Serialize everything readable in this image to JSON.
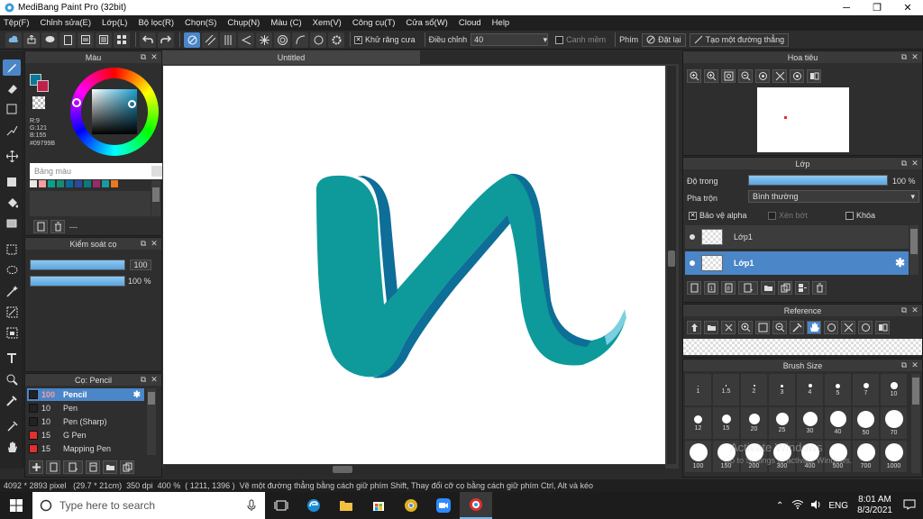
{
  "window": {
    "title": "MediBang Paint Pro (32bit)",
    "controls": [
      "minimize-icon",
      "maximize-icon",
      "close-icon"
    ]
  },
  "menu": [
    "Tệp(F)",
    "Chỉnh sửa(E)",
    "Lớp(L)",
    "Bộ lọc(R)",
    "Chọn(S)",
    "Chụp(N)",
    "Màu (C)",
    "Xem(V)",
    "Công cụ(T)",
    "Cửa sổ(W)",
    "Cloud",
    "Help"
  ],
  "toolbar": {
    "antialias_label": "Khử răng cưa",
    "antialias_checked": true,
    "correction_label": "Điều chỉnh",
    "correction_value": "40",
    "edge_label": "Canh mềm",
    "edge_checked": false,
    "key_label": "Phím",
    "reset_label": "Đặt lại",
    "straight_label": "Tạo một đường thẳng"
  },
  "color_panel": {
    "title": "Màu",
    "rgb_r": "R:9",
    "rgb_g": "G:121",
    "rgb_b": "B:155",
    "hex": "#09799B",
    "palette_label": "Bảng màu",
    "palette_more": "---",
    "foreground": "#09799b",
    "swatches": [
      "#e8e8e8",
      "#f0a0a0",
      "#0aa090",
      "#1a8a70",
      "#0a6aa0",
      "#2a4a9a",
      "#0a7a7a",
      "#9a2a6a",
      "#1a9aa0",
      "#e87a20"
    ]
  },
  "brush_control": {
    "title": "Kiểm soát cọ",
    "size_value": "100",
    "opacity_value": "100 %",
    "size_fraction": 0.96,
    "opacity_fraction": 1.0
  },
  "brush_panel": {
    "title": "Cọ: Pencil",
    "items": [
      {
        "size": "100",
        "name": "Pencil",
        "color": "#222222",
        "selected": true
      },
      {
        "size": "10",
        "name": "Pen",
        "color": "#222222",
        "selected": false
      },
      {
        "size": "10",
        "name": "Pen (Sharp)",
        "color": "#222222",
        "selected": false
      },
      {
        "size": "15",
        "name": "G Pen",
        "color": "#e03030",
        "selected": false
      },
      {
        "size": "15",
        "name": "Mapping Pen",
        "color": "#e03030",
        "selected": false
      }
    ]
  },
  "canvas": {
    "tab_title": "Untitled"
  },
  "navigator": {
    "title": "Hoa tiêu"
  },
  "layer_panel": {
    "title": "Lớp",
    "opacity_label": "Độ trong",
    "opacity_value": "100 %",
    "blend_label": "Pha trộn",
    "blend_value": "Bình thường",
    "protect_alpha_label": "Bảo vệ alpha",
    "protect_alpha_checked": true,
    "clipping_label": "Xén bớt",
    "lock_label": "Khóa",
    "layers": [
      {
        "name": "Lớp1",
        "selected": false
      },
      {
        "name": "Lớp1",
        "selected": true
      }
    ]
  },
  "reference_panel": {
    "title": "Reference"
  },
  "brush_size_panel": {
    "title": "Brush Size",
    "sizes": [
      "1",
      "1.5",
      "2",
      "3",
      "4",
      "5",
      "7",
      "10",
      "12",
      "15",
      "20",
      "25",
      "30",
      "40",
      "50",
      "70",
      "100",
      "150",
      "200",
      "300",
      "400",
      "500",
      "700",
      "1000"
    ]
  },
  "watermark": {
    "line1": "Activate Windows",
    "line2": "Go to Settings to activate Windows."
  },
  "status": {
    "dims": "4092 * 2893 pixel",
    "size_cm": "(29.7 * 21cm)",
    "dpi": "350 dpi",
    "zoom": "400 %",
    "coords": "( 1211, 1396 )",
    "hint": "Vẽ một đường thẳng bằng cách giữ phím Shift, Thay đổi cỡ cọ bằng cách giữ phím Ctrl, Alt và kéo"
  },
  "taskbar": {
    "search_placeholder": "Type here to search",
    "lang": "ENG",
    "time": "8:01 AM",
    "date": "8/3/2021"
  }
}
